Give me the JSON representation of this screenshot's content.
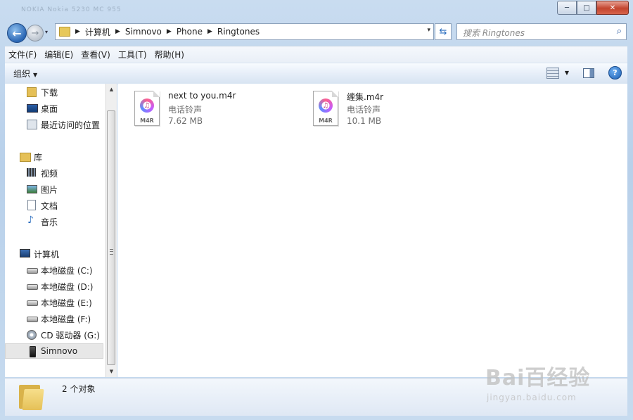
{
  "window": {
    "title": "NOKIA Nokia 5230 MC 955",
    "minimize_glyph": "─",
    "maximize_glyph": "□",
    "close_glyph": "✕"
  },
  "nav": {
    "back_glyph": "←",
    "forward_glyph": "→",
    "history_glyph": "▾",
    "address_dropdown_glyph": "▾",
    "refresh_glyph": "⇆",
    "breadcrumbs": [
      "计算机",
      "Simnovo",
      "Phone",
      "Ringtones"
    ],
    "separator": "▶",
    "search_placeholder": "搜索 Ringtones",
    "search_icon_glyph": "⌕"
  },
  "menubar": {
    "items": [
      "文件(F)",
      "编辑(E)",
      "查看(V)",
      "工具(T)",
      "帮助(H)"
    ]
  },
  "toolbar": {
    "organize_label": "组织",
    "caret": "▼",
    "view_caret": "▼",
    "help_glyph": "?"
  },
  "sidebar": {
    "items": [
      {
        "label": "下载",
        "icon": "download-folder-icon"
      },
      {
        "label": "桌面",
        "icon": "desktop-icon"
      },
      {
        "label": "最近访问的位置",
        "icon": "recent-places-icon"
      },
      {
        "label": "库",
        "icon": "libraries-icon"
      },
      {
        "label": "视频",
        "icon": "video-icon"
      },
      {
        "label": "图片",
        "icon": "pictures-icon"
      },
      {
        "label": "文档",
        "icon": "documents-icon"
      },
      {
        "label": "音乐",
        "icon": "music-icon"
      },
      {
        "label": "计算机",
        "icon": "computer-icon"
      },
      {
        "label": "本地磁盘 (C:)",
        "icon": "drive-icon"
      },
      {
        "label": "本地磁盘 (D:)",
        "icon": "drive-icon"
      },
      {
        "label": "本地磁盘 (E:)",
        "icon": "drive-icon"
      },
      {
        "label": "本地磁盘 (F:)",
        "icon": "drive-icon"
      },
      {
        "label": "CD 驱动器 (G:)",
        "icon": "cd-drive-icon"
      },
      {
        "label": "Simnovo",
        "icon": "phone-icon",
        "selected": true
      }
    ],
    "scroll_up_glyph": "▲",
    "scroll_down_glyph": "▼"
  },
  "files": [
    {
      "name": "next to you.m4r",
      "type": "电话铃声",
      "size": "7.62 MB",
      "badge": "M4R",
      "note_glyph": "♫"
    },
    {
      "name": "缠集.m4r",
      "type": "电话铃声",
      "size": "10.1 MB",
      "badge": "M4R",
      "note_glyph": "♫"
    }
  ],
  "details": {
    "count_text": "2 个对象"
  },
  "watermark": {
    "logo": "Bai百经验",
    "url": "jingyan.baidu.com"
  },
  "colors": {
    "accent": "#2a66b4",
    "close_red": "#c3452f",
    "folder": "#e5c057"
  }
}
